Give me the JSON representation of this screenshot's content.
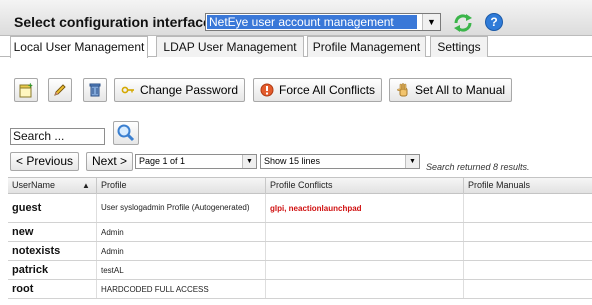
{
  "header": {
    "title": "Select configuration interface:",
    "interface_value": "NetEye user account management",
    "refresh_icon": "refresh-icon",
    "help_icon": "help-icon",
    "help_glyph": "?"
  },
  "tabs": [
    {
      "label": "Local User Management",
      "active": true
    },
    {
      "label": "LDAP User Management",
      "active": false
    },
    {
      "label": "Profile Management",
      "active": false
    },
    {
      "label": "Settings",
      "active": false
    }
  ],
  "toolbar": {
    "new_icon": "new-user-icon",
    "edit_icon": "edit-icon",
    "delete_icon": "delete-icon",
    "change_password": "Change Password",
    "force_conflicts": "Force All Conflicts",
    "set_manual": "Set All to Manual"
  },
  "search": {
    "value": "Search ...",
    "button_icon": "magnifier-icon"
  },
  "pager": {
    "previous": "< Previous",
    "next": "Next >",
    "page": "Page 1 of 1",
    "lines": "Show 15 lines",
    "result": "Search returned 8 results."
  },
  "table": {
    "columns": [
      "UserName",
      "Profile",
      "Profile Conflicts",
      "Profile Manuals"
    ],
    "sort_glyph": "▲",
    "rows": [
      {
        "user": "guest",
        "profile": "User syslogadmin Profile (Autogenerated)",
        "conflicts": "glpi, neactionlaunchpad",
        "manuals": ""
      },
      {
        "user": "new",
        "profile": "Admin",
        "conflicts": "",
        "manuals": ""
      },
      {
        "user": "notexists",
        "profile": "Admin",
        "conflicts": "",
        "manuals": ""
      },
      {
        "user": "patrick",
        "profile": "testAL",
        "conflicts": "",
        "manuals": ""
      },
      {
        "user": "root",
        "profile": "HARDCODED FULL ACCESS",
        "conflicts": "",
        "manuals": ""
      }
    ]
  },
  "colors": {
    "select_highlight": "#3a78d8",
    "conflict_text": "#d01010",
    "refresh_green": "#3bb54a",
    "help_blue": "#2f7bd8"
  }
}
